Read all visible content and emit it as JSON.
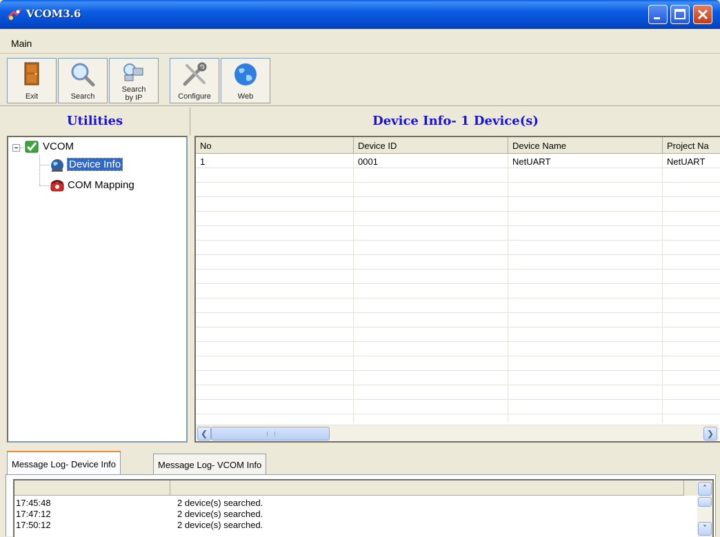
{
  "window": {
    "title": "VCOM3.6",
    "buttons": [
      "minimize",
      "maximize",
      "close"
    ]
  },
  "menu": {
    "main_label": "Main"
  },
  "toolbar": {
    "exit_label": "Exit",
    "search_label": "Search",
    "search_ip_line1": "Search",
    "search_ip_line2": "by IP",
    "configure_label": "Configure",
    "web_label": "Web"
  },
  "left_panel": {
    "header": "Utilities",
    "tree": {
      "root_label": "VCOM",
      "children": [
        {
          "label": "Device Info",
          "selected": true
        },
        {
          "label": "COM Mapping",
          "selected": false
        }
      ]
    }
  },
  "right_panel": {
    "header": "Device Info- 1 Device(s)",
    "columns": [
      "No",
      "Device ID",
      "Device Name",
      "Project Na"
    ],
    "rows": [
      [
        "1",
        "0001",
        "NetUART",
        "NetUART"
      ]
    ]
  },
  "bottom": {
    "tabs": [
      {
        "label": "Message Log- Device Info",
        "active": true
      },
      {
        "label": "Message Log- VCOM Info",
        "active": false
      }
    ],
    "log": [
      {
        "time": "17:45:48",
        "message": "2 device(s) searched."
      },
      {
        "time": "17:47:12",
        "message": "2 device(s) searched."
      },
      {
        "time": "17:50:12",
        "message": "2 device(s) searched."
      }
    ]
  },
  "colors": {
    "title_bar": "#0a5fe4",
    "header_text": "#1a14c9",
    "selection": "#316ac5",
    "window_bg": "#ece9d8"
  }
}
